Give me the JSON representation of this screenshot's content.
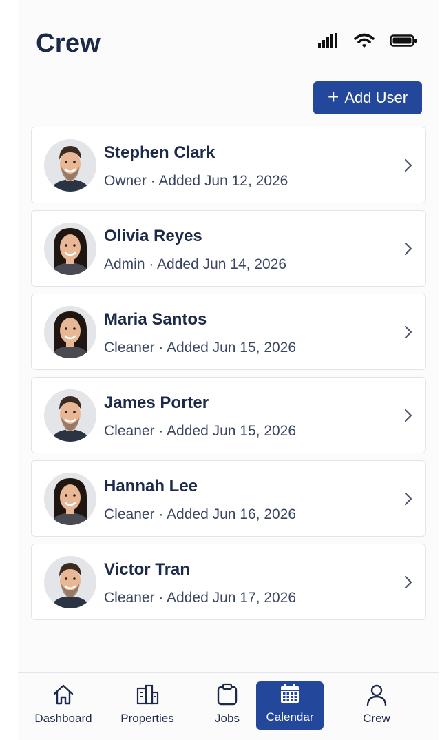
{
  "header": {
    "title": "Crew",
    "add_user_label": "Add User"
  },
  "status_icons": [
    "signal-icon",
    "wifi-icon",
    "battery-icon"
  ],
  "users": [
    {
      "name": "Stephen Clark",
      "meta": "Owner · Added Jun 12, 2026",
      "gender": "m"
    },
    {
      "name": "Olivia Reyes",
      "meta": "Admin · Added Jun 14, 2026",
      "gender": "f"
    },
    {
      "name": "Maria Santos",
      "meta": "Cleaner · Added Jun 15, 2026",
      "gender": "f"
    },
    {
      "name": "James Porter",
      "meta": "Cleaner · Added Jun 15, 2026",
      "gender": "m"
    },
    {
      "name": "Hannah Lee",
      "meta": "Cleaner · Added Jun 16, 2026",
      "gender": "f"
    },
    {
      "name": "Victor Tran",
      "meta": "Cleaner · Added Jun 17, 2026",
      "gender": "m"
    }
  ],
  "nav": {
    "items": [
      {
        "label": "Dashboard",
        "icon": "home-icon",
        "active": false
      },
      {
        "label": "Properties",
        "icon": "buildings-icon",
        "active": false
      },
      {
        "label": "Jobs",
        "icon": "clipboard-icon",
        "active": false
      },
      {
        "label": "Calendar",
        "icon": "calendar-icon",
        "active": true
      },
      {
        "label": "Crew",
        "icon": "person-icon",
        "active": false
      }
    ]
  },
  "colors": {
    "accent": "#22479b",
    "text": "#1c2a4a",
    "card_border": "#e2e4e9"
  }
}
